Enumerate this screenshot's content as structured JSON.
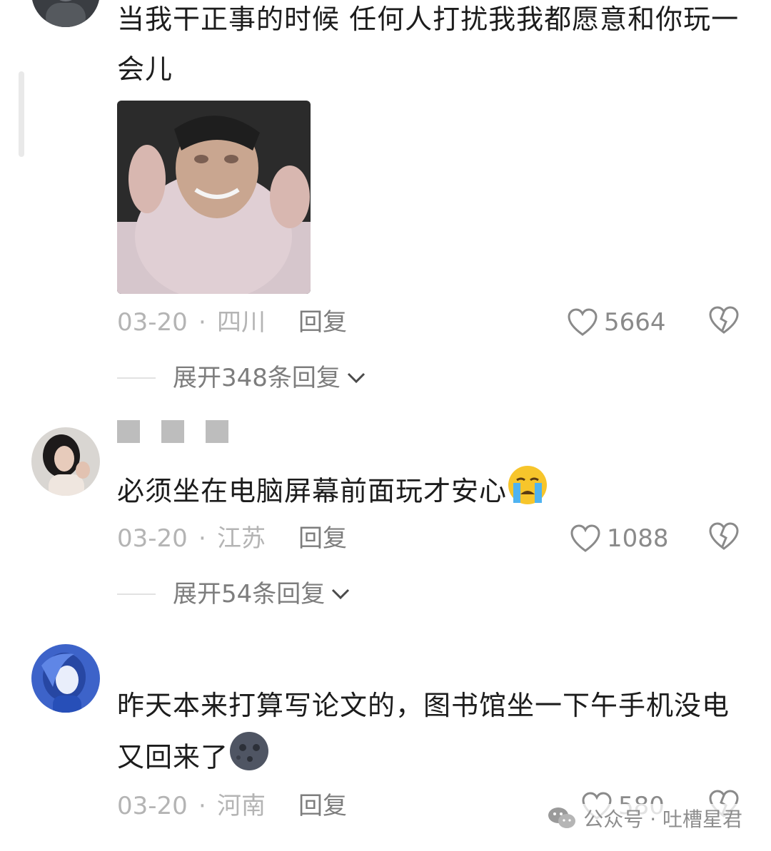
{
  "comments": [
    {
      "text": "当我干正事的时候 任何人打扰我我都愿意和你玩一会儿",
      "date": "03-20",
      "separator": "·",
      "location": "四川",
      "reply_label": "回复",
      "likes": "5664",
      "expand_label": "展开348条回复"
    },
    {
      "text": "必须坐在电脑屏幕前面玩才安心",
      "emoji": "crying-face-emoji",
      "date": "03-20",
      "separator": "·",
      "location": "江苏",
      "reply_label": "回复",
      "likes": "1088",
      "expand_label": "展开54条回复"
    },
    {
      "text": "昨天本来打算写论文的，图书馆坐一下午手机没电又回来了",
      "emoji": "new-moon-face-emoji",
      "date": "03-20",
      "separator": "·",
      "location": "河南",
      "reply_label": "回复",
      "likes": "580"
    }
  ],
  "watermark": {
    "icon": "wechat-icon",
    "text": "公众号 · 吐槽星君"
  },
  "colors": {
    "meta_gray": "#b4b4b4",
    "reply_gray": "#7d7d7d",
    "text": "#1c1c1c"
  }
}
